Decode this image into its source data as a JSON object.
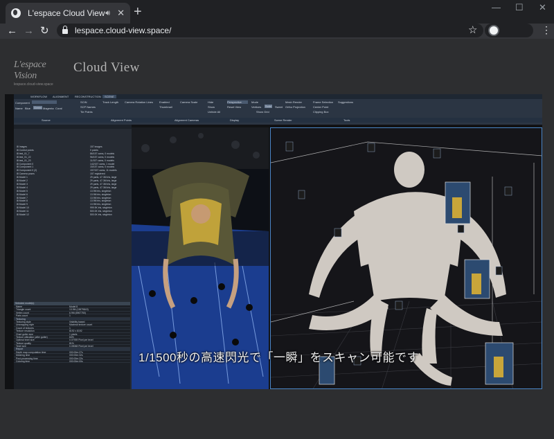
{
  "browser": {
    "tab_title": "L'espace Cloud View",
    "tab_audio_icon": "speaker-icon",
    "new_tab": "+",
    "minimize": "—",
    "maximize": "☐",
    "close": "✕",
    "back": "←",
    "forward": "→",
    "reload": "↻",
    "url": "lespace.cloud-view.space/",
    "star": "☆",
    "menu": "⋮"
  },
  "site": {
    "logo_main": "L'espace Vision",
    "logo_sub": "lespace.cloud-view.space",
    "brand": "Cloud View"
  },
  "video": {
    "subtitle": "1/1500秒の高速閃光で「一瞬」をスキャン可能です",
    "app": {
      "tabs": [
        "WORKFLOW",
        "ALIGNMENT",
        "RECONSTRUCTION",
        "SCENE"
      ],
      "ribbon_groups": [
        "Source",
        "Alignment Points",
        "Alignment Cameras",
        "Display",
        "Scene Render",
        "Tools"
      ],
      "ribbon_items": [
        "Component",
        "SCIN",
        "SCP Names",
        "Tie Points",
        "Track Length",
        "Camera Rotation Lines",
        "Enabled",
        "Thumbnail",
        "Camera Scale",
        "Hide",
        "Show",
        "Unhide All",
        "Mode",
        "Vertices",
        "Solid",
        "Sweet",
        "Show Grid",
        "Mesh Render",
        "Ortho Projection",
        "Frame Selection",
        "Suggestions",
        "Center Point",
        "Clipping Box",
        "Perspective",
        "Reset View",
        "Name",
        "Blue",
        "Green",
        "Magenta",
        "Coral"
      ],
      "tree": [
        {
          "name": "Images",
          "value": "157 images"
        },
        {
          "name": "Control points",
          "value": "0 points"
        },
        {
          "name": "test_01_7",
          "value": "86/157 cams, 0 models"
        },
        {
          "name": "test_01_22",
          "value": "96/157 cams, 0 models"
        },
        {
          "name": "test_01_23",
          "value": "11/157 cams, 0 models"
        },
        {
          "name": "Component 0",
          "value": "142/157 cams, 1 model"
        },
        {
          "name": "Component 1",
          "value": "15/157 cams, 0 models"
        },
        {
          "name": "Component 0 (2)",
          "value": "157/157 cams, 11 models"
        },
        {
          "name": "Camera poses",
          "value": "157 registered"
        },
        {
          "name": "Model 1",
          "value": "29 parts, 47.3M tris, large"
        },
        {
          "name": "Model 2",
          "value": "29 parts, 47.3M tris, large"
        },
        {
          "name": "Model 3",
          "value": "29 parts, 47.3M tris, large"
        },
        {
          "name": "Model 4",
          "value": "29 parts, 47.3M tris, large"
        },
        {
          "name": "Model 5",
          "value": "13.9M tris, singleton"
        },
        {
          "name": "Model 6",
          "value": "13.9M tris, singleton"
        },
        {
          "name": "Model 7",
          "value": "13.9M tris, singleton"
        },
        {
          "name": "Model 8",
          "value": "13.9M tris, singleton"
        },
        {
          "name": "Model 9",
          "value": "13.9M tris, singleton"
        },
        {
          "name": "Model 10",
          "value": "999.9K tris, singleton"
        },
        {
          "name": "Model 11",
          "value": "500.0K tris, singleton"
        },
        {
          "name": "Model 12",
          "value": "500.0K tris, singleton"
        }
      ],
      "props_title": "Selected model(s)",
      "props": [
        {
          "k": "Name",
          "v": "Model 8"
        },
        {
          "k": "Triangle count",
          "v": "13.9M (13879843)"
        },
        {
          "k": "Vertex count",
          "v": "6.9M (6967750)"
        },
        {
          "k": "Parts count",
          "v": "1"
        },
        {
          "k": "Texturing",
          "v": ""
        },
        {
          "k": "Texturing style",
          "v": "Visibility based"
        },
        {
          "k": "Unwrapping style",
          "v": "Maximal texture count"
        },
        {
          "k": "Count of textures",
          "v": "1"
        },
        {
          "k": "Texture resolution",
          "v": "8192 x 8192"
        },
        {
          "k": "Chart gutter size",
          "v": "1 pixels"
        },
        {
          "k": "Texture utilization (after gutter)",
          "v": "84%"
        },
        {
          "k": "Optimal texel size",
          "v": "0.07939 Pixel per texel"
        },
        {
          "k": "Texture quality",
          "v": "81%"
        },
        {
          "k": "Texel size",
          "v": "0.05068 Pixel per texel"
        },
        {
          "k": "Report",
          "v": ""
        },
        {
          "k": "Depth map computation time",
          "v": "000:00m:27s"
        },
        {
          "k": "Meshing time",
          "v": "000:00m:32s"
        },
        {
          "k": "Post-processing time",
          "v": "000:00m:22s"
        },
        {
          "k": "Coloring time",
          "v": "000:00m:00s"
        }
      ]
    }
  }
}
